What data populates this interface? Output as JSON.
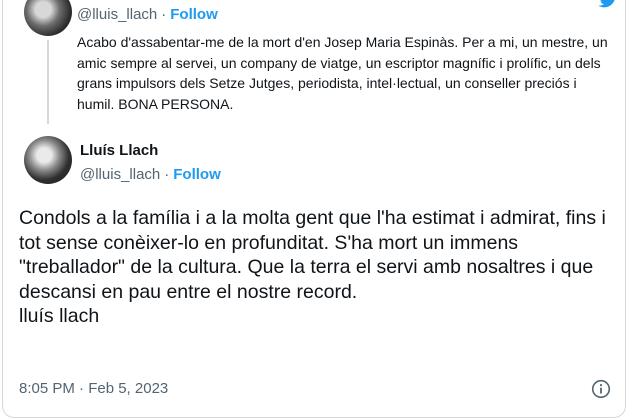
{
  "quoted_tweet": {
    "handle": "@lluis_llach",
    "separator": "·",
    "follow_label": "Follow",
    "text": "Acabo d'assabentar-me de la mort d'en Josep Maria Espinàs. Per a mi, un mestre, un amic sempre al servei, un company de viatge, un escriptor magnífic i prolífic, un dels grans impulsors dels Setze Jutges, periodista, intel·lectual, un conseller preciós i humil. BONA PERSONA."
  },
  "tweet": {
    "display_name": "Lluís Llach",
    "handle": "@lluis_llach",
    "separator": "·",
    "follow_label": "Follow",
    "text": "Condols a la família i a la molta gent que l'ha estimat i admirat, fins i tot sense conèixer-lo en profunditat. S'ha mort un immens \"treballador\" de la cultura. Que la terra el servi amb nosaltres i que descansi en pau entre el nostre record.\nlluís llach",
    "timestamp": "8:05 PM · Feb 5, 2023"
  },
  "icons": {
    "brand": "twitter-bird-icon",
    "info": "info-icon"
  },
  "colors": {
    "accent": "#1d9bf0",
    "secondary_text": "#536471",
    "primary_text": "#0f1419",
    "border": "#cfd9de"
  }
}
